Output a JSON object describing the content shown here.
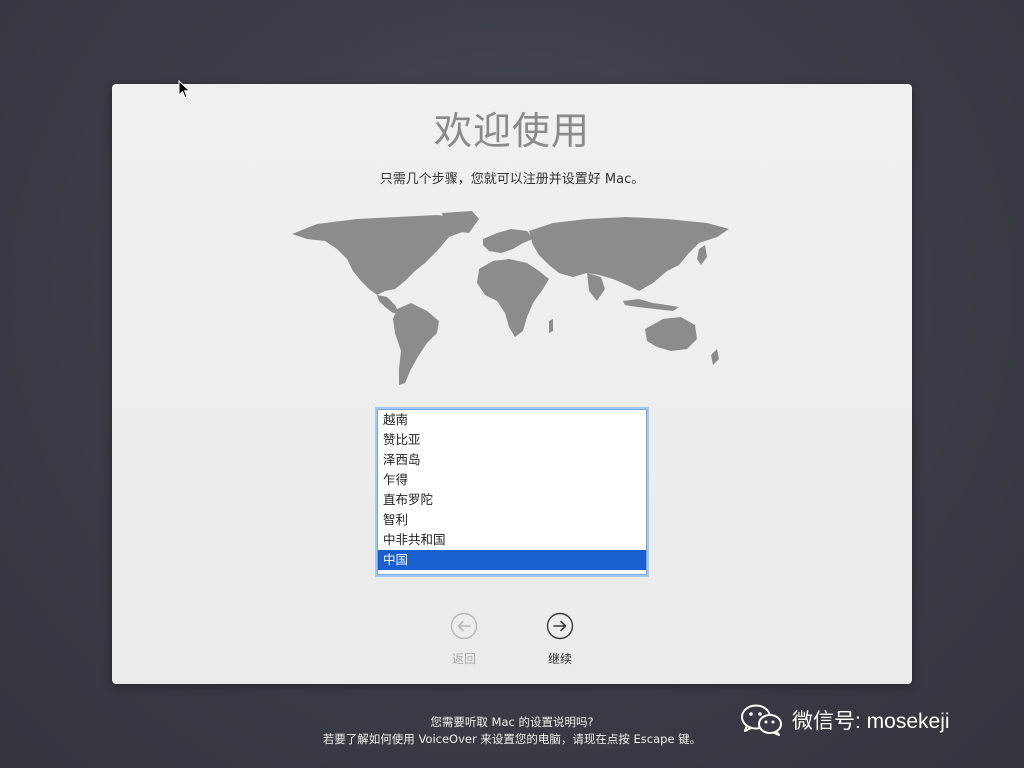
{
  "setup": {
    "title": "欢迎使用",
    "subtitle": "只需几个步骤，您就可以注册并设置好 Mac。",
    "country_list": {
      "items": [
        "越南",
        "赞比亚",
        "泽西岛",
        "乍得",
        "直布罗陀",
        "智利",
        "中非共和国",
        "中国"
      ],
      "selected": "中国"
    },
    "back_label": "返回",
    "continue_label": "继续"
  },
  "footer": {
    "line1": "您需要听取 Mac 的设置说明吗?",
    "line2": "若要了解如何使用 VoiceOver 来设置您的电脑，请现在点按 Escape 键。"
  },
  "watermark": {
    "text": "微信号: mosekeji",
    "icon": "wechat-icon"
  },
  "colors": {
    "selection": "#1a5fd0",
    "list_focus_ring": "#6ea6e6"
  }
}
